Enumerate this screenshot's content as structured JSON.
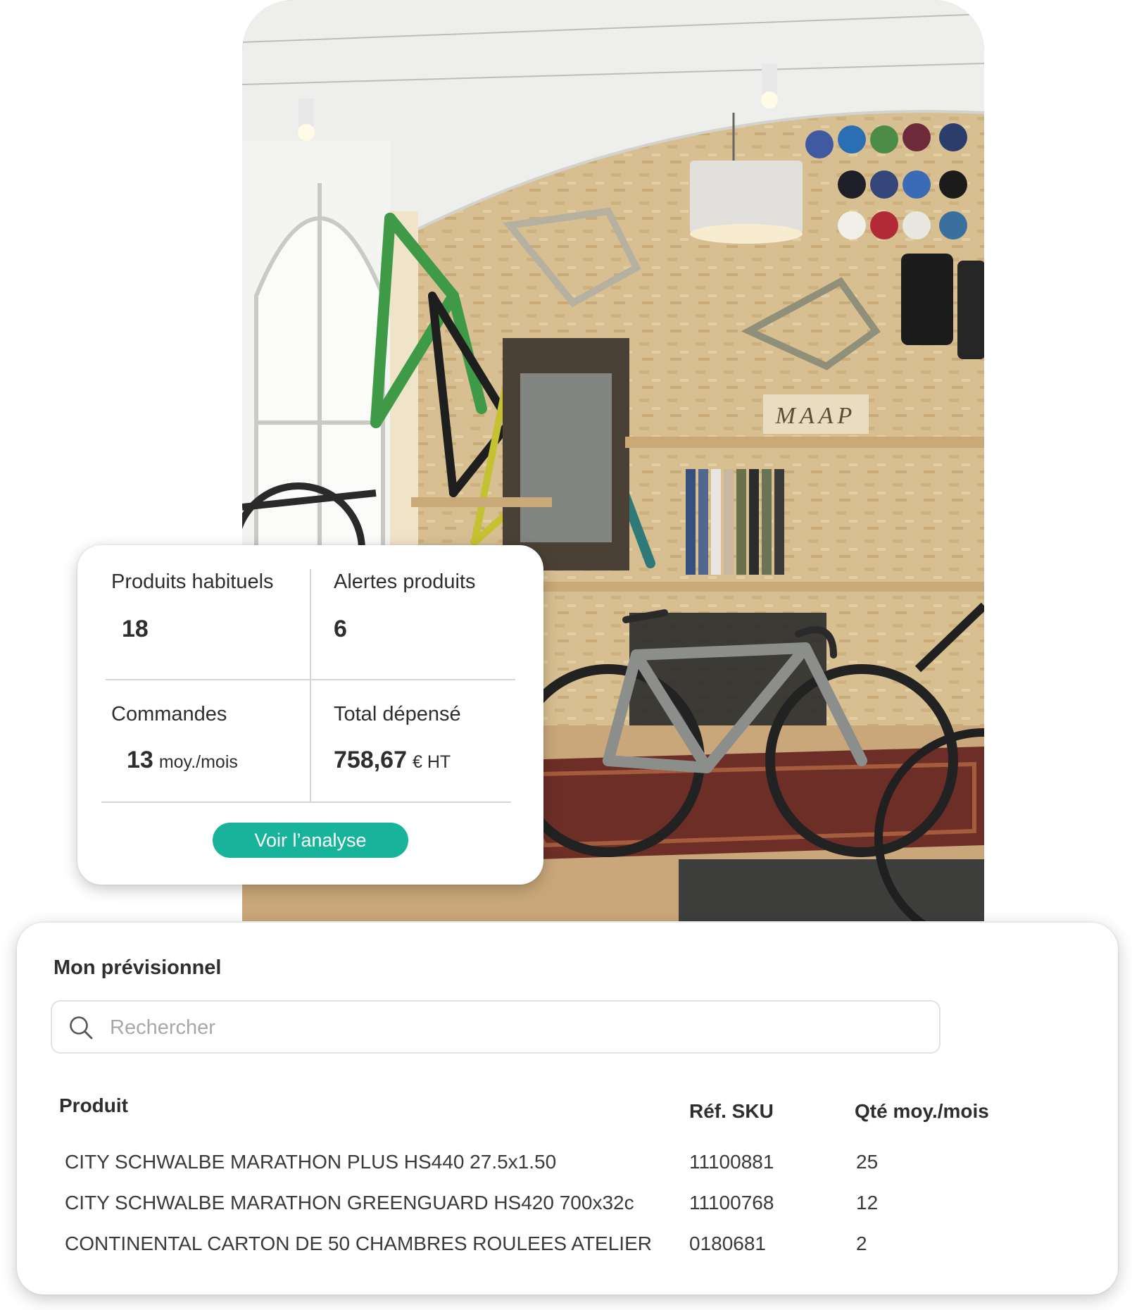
{
  "stats": {
    "usual_products": {
      "label": "Produits habituels",
      "value": "18"
    },
    "product_alerts": {
      "label": "Alertes produits",
      "value": "6"
    },
    "orders": {
      "label": "Commandes",
      "value": "13",
      "unit": "moy./mois"
    },
    "total_spent": {
      "label": "Total dépensé",
      "value": "758,67",
      "unit": "€ HT"
    },
    "cta_label": "Voir l’analyse",
    "accent_color": "#17b39a"
  },
  "forecast": {
    "title": "Mon prévisionnel",
    "search_placeholder": "Rechercher",
    "search_icon": "search-icon",
    "columns": {
      "product": "Produit",
      "sku": "Réf. SKU",
      "qty": "Qté moy./mois"
    },
    "rows": [
      {
        "product": "CITY SCHWALBE MARATHON PLUS HS440 27.5x1.50",
        "sku": "11100881",
        "qty": "25"
      },
      {
        "product": "CITY SCHWALBE MARATHON GREENGUARD HS420 700x32c",
        "sku": "11100768",
        "qty": "12"
      },
      {
        "product": "CONTINENTAL CARTON DE 50 CHAMBRES ROULEES ATELIER",
        "sku": "0180681",
        "qty": "2"
      }
    ]
  },
  "photo_sign_text": "MAAP"
}
